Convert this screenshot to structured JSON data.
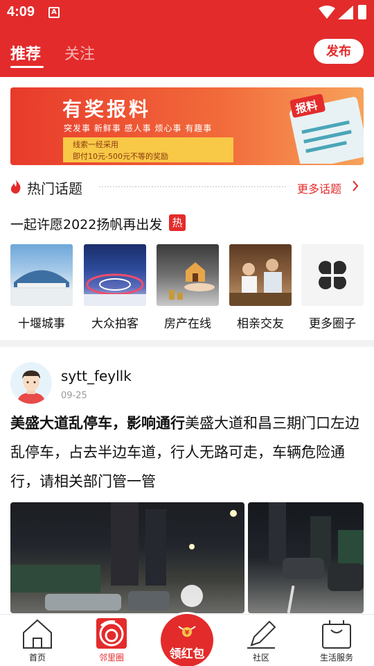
{
  "status_bar": {
    "time": "4:09",
    "notification_icon": "A"
  },
  "header": {
    "tabs": [
      {
        "label": "推荐",
        "active": true
      },
      {
        "label": "关注",
        "active": false
      }
    ],
    "publish_label": "发布"
  },
  "banner": {
    "title": "有奖报料",
    "tags": "突发事  新鲜事  感人事  烦心事  有趣事",
    "note_line1": "线索一经采用",
    "note_line2": "即付10元-500元不等的奖励",
    "paper_text": "报料"
  },
  "hot_topics": {
    "title": "热门话题",
    "more_label": "更多话题",
    "topic": "一起许愿2022扬帆再出发",
    "badge": "热"
  },
  "circles": [
    {
      "label": "十堰城事",
      "image": "city-square-photo"
    },
    {
      "label": "大众拍客",
      "image": "night-interchange-photo"
    },
    {
      "label": "房产在线",
      "image": "house-model-photo"
    },
    {
      "label": "相亲交友",
      "image": "cafe-couple-photo"
    },
    {
      "label": "更多圈子",
      "image": "four-leaf-icon"
    }
  ],
  "post": {
    "username": "sytt_feyllk",
    "date": "09-25",
    "headline": "美盛大道乱停车，影响通行",
    "body": "美盛大道和昌三期门口左边乱停车，占去半边车道，行人无路可走，车辆危险通行，请相关部门管一管"
  },
  "bottom_nav": {
    "items": [
      {
        "label": "首页",
        "icon": "home-icon",
        "active": false
      },
      {
        "label": "邻里圈",
        "icon": "neighbor-circle-icon",
        "active": true
      },
      {
        "label": "社区",
        "icon": "pen-icon",
        "active": false
      },
      {
        "label": "生活服务",
        "icon": "shopping-bag-icon",
        "active": false
      }
    ],
    "center_label": "领红包",
    "center_symbol": "¥"
  },
  "colors": {
    "brand_red": "#e32b2b"
  }
}
